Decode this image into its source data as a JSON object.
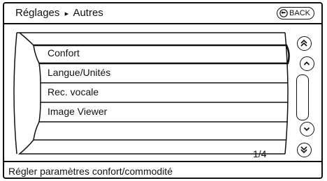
{
  "header": {
    "breadcrumb_parent": "Réglages",
    "breadcrumb_separator": "▸",
    "breadcrumb_current": "Autres",
    "back_label": "BACK"
  },
  "menu": {
    "items": [
      {
        "label": "Confort"
      },
      {
        "label": "Langue/Unités"
      },
      {
        "label": "Rec. vocale"
      },
      {
        "label": "Image Viewer"
      },
      {
        "label": ""
      }
    ],
    "selected_index": 0,
    "page_indicator": "1/4"
  },
  "scroll": {
    "page_up_icon": "double-chevron-up-icon",
    "line_up_icon": "chevron-up-icon",
    "line_down_icon": "chevron-down-icon",
    "page_down_icon": "double-chevron-down-icon"
  },
  "status": {
    "text": "Régler paramètres confort/commodité"
  },
  "colors": {
    "line": "#111111",
    "background": "#ffffff"
  }
}
